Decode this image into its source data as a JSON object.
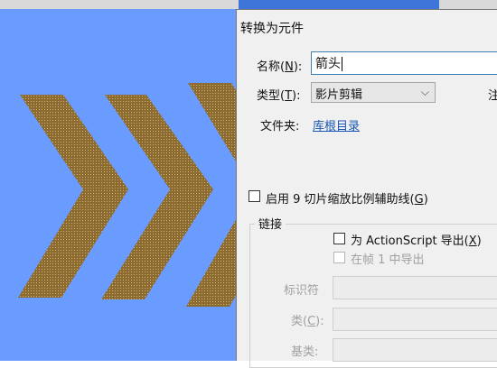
{
  "colors": {
    "canvas": "#6a9cff",
    "arrow": "#8d6a2d",
    "dialog": "#f0f0f0",
    "link": "#1a55b5",
    "focus": "#3c7fb1"
  },
  "dialog": {
    "title": "转换为元件",
    "name_label": "名称(",
    "name_mnemonic": "N",
    "name_label_close": "):",
    "name_value": "箭头",
    "type_label": "类型(",
    "type_mnemonic": "T",
    "type_label_close": "):",
    "type_value": "影片剪辑",
    "right_edge_char": "注",
    "folder_label": "文件夹:",
    "folder_link": "库根目录",
    "enable_9slice": "启用 9 切片缩放比例辅助线(",
    "enable_9slice_mnemonic": "G",
    "enable_9slice_close": ")",
    "linkage": {
      "title": "链接",
      "export_as": "为 ActionScript 导出(",
      "export_as_mnemonic": "X",
      "export_as_close": ")",
      "export_frame": "在帧 1 中导出",
      "identifier_label": "标识符",
      "class_label": "类(",
      "class_mnemonic": "C",
      "class_close": "):",
      "base_class_label": "基类:"
    }
  },
  "icons": {
    "dropdown": "chevron-down-icon"
  }
}
